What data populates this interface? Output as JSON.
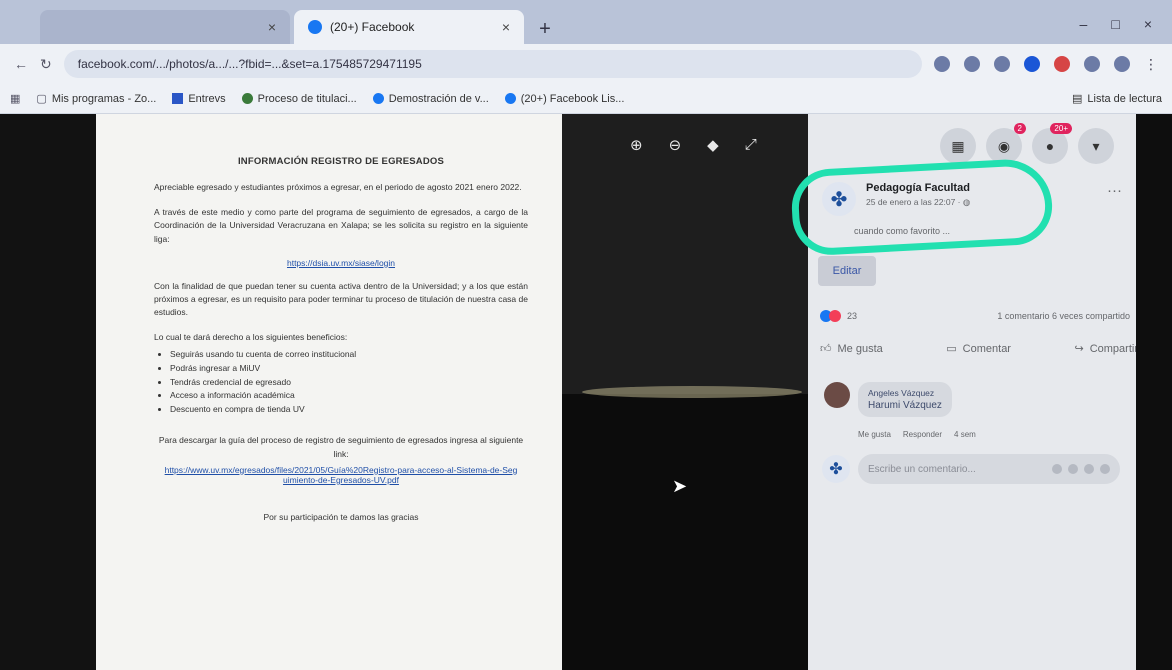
{
  "browser": {
    "tabs": [
      {
        "label": "",
        "active": false
      },
      {
        "label": "(20+) Facebook",
        "active": true
      }
    ],
    "url": "facebook.com/.../photos/a.../...?fbid=...&set=a.175485729471195",
    "bookmarks": [
      "Mis programas - Zo...",
      "Entrevs",
      "Proceso de titulaci...",
      "Demostración de v...",
      "(20+) Facebook Lis..."
    ],
    "bookmarks_right": "Lista de lectura"
  },
  "document": {
    "title": "INFORMACIÓN REGISTRO DE EGRESADOS",
    "para1": "Apreciable egresado y estudiantes próximos a egresar, en el periodo de agosto 2021 enero 2022.",
    "para2": "A través de este medio y como parte del programa de seguimiento de egresados, a cargo de la Coordinación de la Universidad Veracruzana en Xalapa; se les solicita su registro en la siguiente liga:",
    "link1": "https://dsia.uv.mx/siase/login",
    "para3": "Con la finalidad de que puedan tener su cuenta activa dentro de la Universidad; y a los que están próximos a egresar, es un requisito para poder terminar tu proceso de titulación de nuestra casa de estudios.",
    "benefits_intro": "Lo cual te dará derecho a los siguientes beneficios:",
    "benefits": [
      "Seguirás usando tu cuenta de correo institucional",
      "Podrás ingresar a MiUV",
      "Tendrás credencial de egresado",
      "Acceso a información académica",
      "Descuento en compra de tienda UV"
    ],
    "para4": "Para descargar la guía del proceso de registro de seguimiento de egresados ingresa al siguiente link:",
    "link2": "https://www.uv.mx/egresados/files/2021/05/Guía%20Registro-para-acceso-al-Sistema-de-Seguimiento-de-Egresados-UV.pdf",
    "thanks": "Por su participación te damos las gracias"
  },
  "fb": {
    "badges": {
      "messenger": "2",
      "notifications": "20+"
    },
    "page_name": "Pedagogía Facultad",
    "post_date": "25 de enero a las 22:07 ·",
    "post_sub": "cuando como favorito ...",
    "edit_label": "Editar",
    "reaction_count": "23",
    "stats": "1 comentario  6 veces compartido",
    "actions": {
      "like": "Me gusta",
      "comment": "Comentar",
      "share": "Compartir"
    },
    "comment": {
      "author": "Angeles Vázquez",
      "text": "Harumi Vázquez",
      "like": "Me gusta",
      "reply": "Responder",
      "time": "4 sem"
    },
    "compose_placeholder": "Escribe un comentario..."
  },
  "colors": {
    "highlight": "#22e0b0",
    "fb_blue": "#1877f2"
  }
}
